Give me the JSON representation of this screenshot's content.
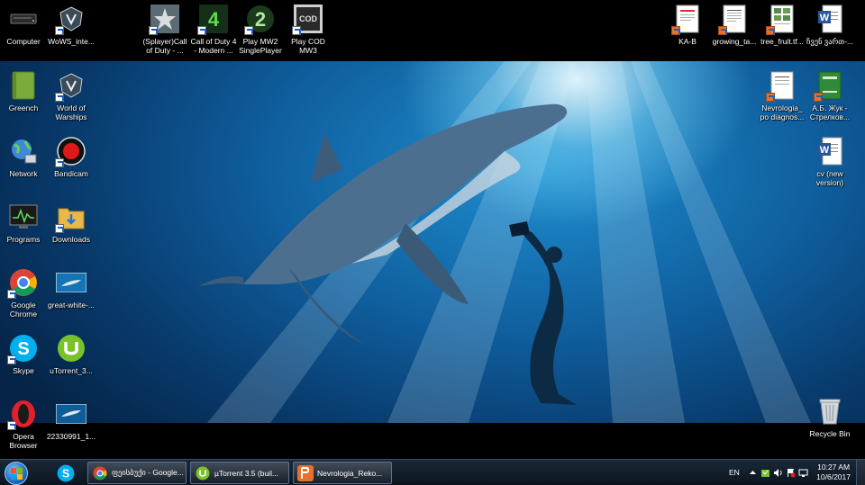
{
  "desktop": {
    "top_icons": [
      {
        "label": "Computer",
        "icon": "computer-icon"
      },
      {
        "label": "WoWS_inte...",
        "icon": "wows-icon"
      },
      {
        "label": "(Splayer)Call\nof Duty - ...",
        "icon": "cod-icon"
      },
      {
        "label": "Call of Duty 4\n- Modern ...",
        "icon": "cod4-icon"
      },
      {
        "label": "Play MW2\nSinglePlayer",
        "icon": "mw2-icon"
      },
      {
        "label": "Play COD\nMW3",
        "icon": "mw3-icon"
      }
    ],
    "top_right_icons": [
      {
        "label": "KA-B",
        "icon": "document-icon"
      },
      {
        "label": "growing_ta...",
        "icon": "document-icon"
      },
      {
        "label": "tree_fruit.tf...",
        "icon": "document-icon"
      },
      {
        "label": "ჩვენ ვართ-...",
        "icon": "word-icon"
      }
    ],
    "left_col1": [
      {
        "label": "Greench",
        "icon": "notebook-icon"
      },
      {
        "label": "Network",
        "icon": "network-icon"
      },
      {
        "label": "Programs",
        "icon": "monitor-icon"
      },
      {
        "label": "Google\nChrome",
        "icon": "chrome-icon"
      },
      {
        "label": "Skype",
        "icon": "skype-icon"
      },
      {
        "label": "Opera\nBrowser",
        "icon": "opera-icon"
      }
    ],
    "left_col2": [
      {
        "label": "World of\nWarships",
        "icon": "warships-icon"
      },
      {
        "label": "Bandicam",
        "icon": "bandicam-icon"
      },
      {
        "label": "Downloads",
        "icon": "folder-icon"
      },
      {
        "label": "great-white-...",
        "icon": "image-icon"
      },
      {
        "label": "uTorrent_3...",
        "icon": "utorrent-icon"
      },
      {
        "label": "22330991_1...",
        "icon": "image-icon"
      }
    ],
    "right_col": [
      {
        "label": "Nevrologia_\npo diagnos...",
        "icon": "document-icon"
      },
      {
        "label": "А.Б. Жук -\nСтрелков...",
        "icon": "book-icon"
      },
      {
        "label": "cv (new\nversion)",
        "icon": "word-icon"
      }
    ],
    "recycle_bin": {
      "label": "Recycle Bin",
      "icon": "recycle-bin-icon"
    }
  },
  "taskbar": {
    "start": "start-button",
    "pinned": [
      {
        "name": "skype-icon"
      }
    ],
    "buttons": [
      {
        "label": "ფეისბუქი - Google...",
        "icon": "chrome-icon"
      },
      {
        "label": "µTorrent 3.5  (buil...",
        "icon": "utorrent-icon"
      },
      {
        "label": "Nevrologia_Reko...",
        "icon": "pdf-icon"
      }
    ],
    "tray": {
      "language": "EN",
      "time": "10:27 AM",
      "date": "10/6/2017"
    }
  },
  "colors": {
    "taskbar": "#122030",
    "ocean_deep": "#083a6c",
    "ocean_light": "#1f8fd0"
  }
}
